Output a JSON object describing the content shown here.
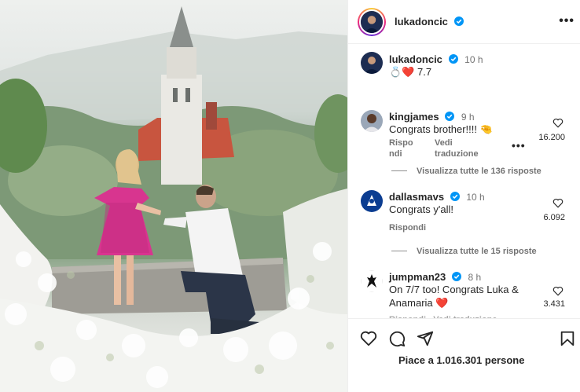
{
  "post": {
    "author": "lukadoncic",
    "caption_time": "10 h",
    "caption_text": "💍❤️ 7.7",
    "likes_summary": "Piace a 1.016.301 persone"
  },
  "comments": [
    {
      "username": "kingjames",
      "time": "9 h",
      "text": "Congrats brother!!!! 🤏",
      "likes": "16.200",
      "reply_label_line1": "Rispo",
      "reply_label_line2": "ndi",
      "translate_label_line1": "Vedi",
      "translate_label_line2": "traduzione",
      "view_replies": "Visualizza tutte le 136 risposte"
    },
    {
      "username": "dallasmavs",
      "time": "10 h",
      "text": "Congrats y'all!",
      "likes": "6.092",
      "reply_label": "Rispondi",
      "view_replies": "Visualizza tutte le 15 risposte"
    },
    {
      "username": "jumpman23",
      "time": "8 h",
      "text_line1": "On 7/7 too! Congrats Luka &",
      "text_line2": "Anamaria ❤️",
      "likes": "3.431",
      "partial_meta": "Rispondi   Vedi traduzione"
    }
  ],
  "icons": {
    "header_more": "more-horizontal-icon",
    "verified": "verified-badge-icon",
    "like": "heart-icon",
    "comment": "comment-icon",
    "share": "share-icon",
    "save": "bookmark-icon"
  },
  "colors": {
    "verified_blue": "#0095f6",
    "text_primary": "#262626",
    "text_secondary": "#737373",
    "dress_pink": "#d8358f"
  }
}
